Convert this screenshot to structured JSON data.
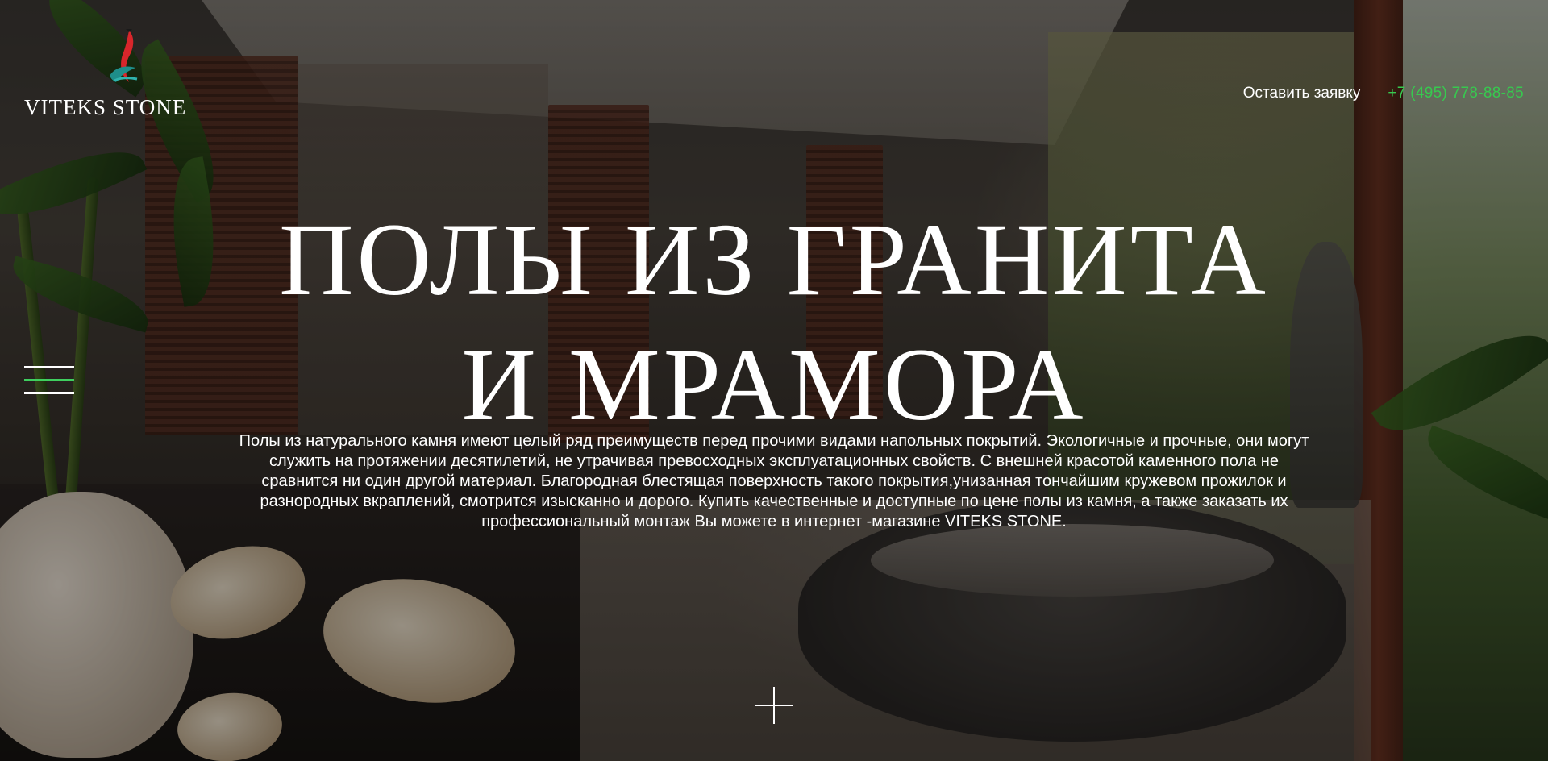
{
  "brand": {
    "logo_text": "VITEKS STONE",
    "accent_color": "#37c94f"
  },
  "header": {
    "request_label": "Оставить заявку",
    "phone": "+7 (495) 778-88-85"
  },
  "menu": {
    "icon": "hamburger-menu-icon"
  },
  "hero": {
    "title_line1": "ПОЛЫ ИЗ ГРАНИТА",
    "title_line2": "И МРАМОРА",
    "description": "Полы из натурального камня имеют целый ряд преимуществ перед прочими видами напольных покрытий. Экологичные и прочные, они могут служить на протяжении десятилетий, не утрачивая превосходных эксплуатационных свойств. С внешней красотой каменного пола не сравнится ни один другой материал. Благородная блестящая поверхность такого покрытия,унизанная тончайшим кружевом прожилок и разнородных вкраплений, смотрится изысканно и дорого. Купить качественные и доступные по цене полы из камня, а также заказать их профессиональный монтаж Вы можете в интернет -магазине VITEKS STONE.",
    "scroll_icon": "plus-icon"
  }
}
